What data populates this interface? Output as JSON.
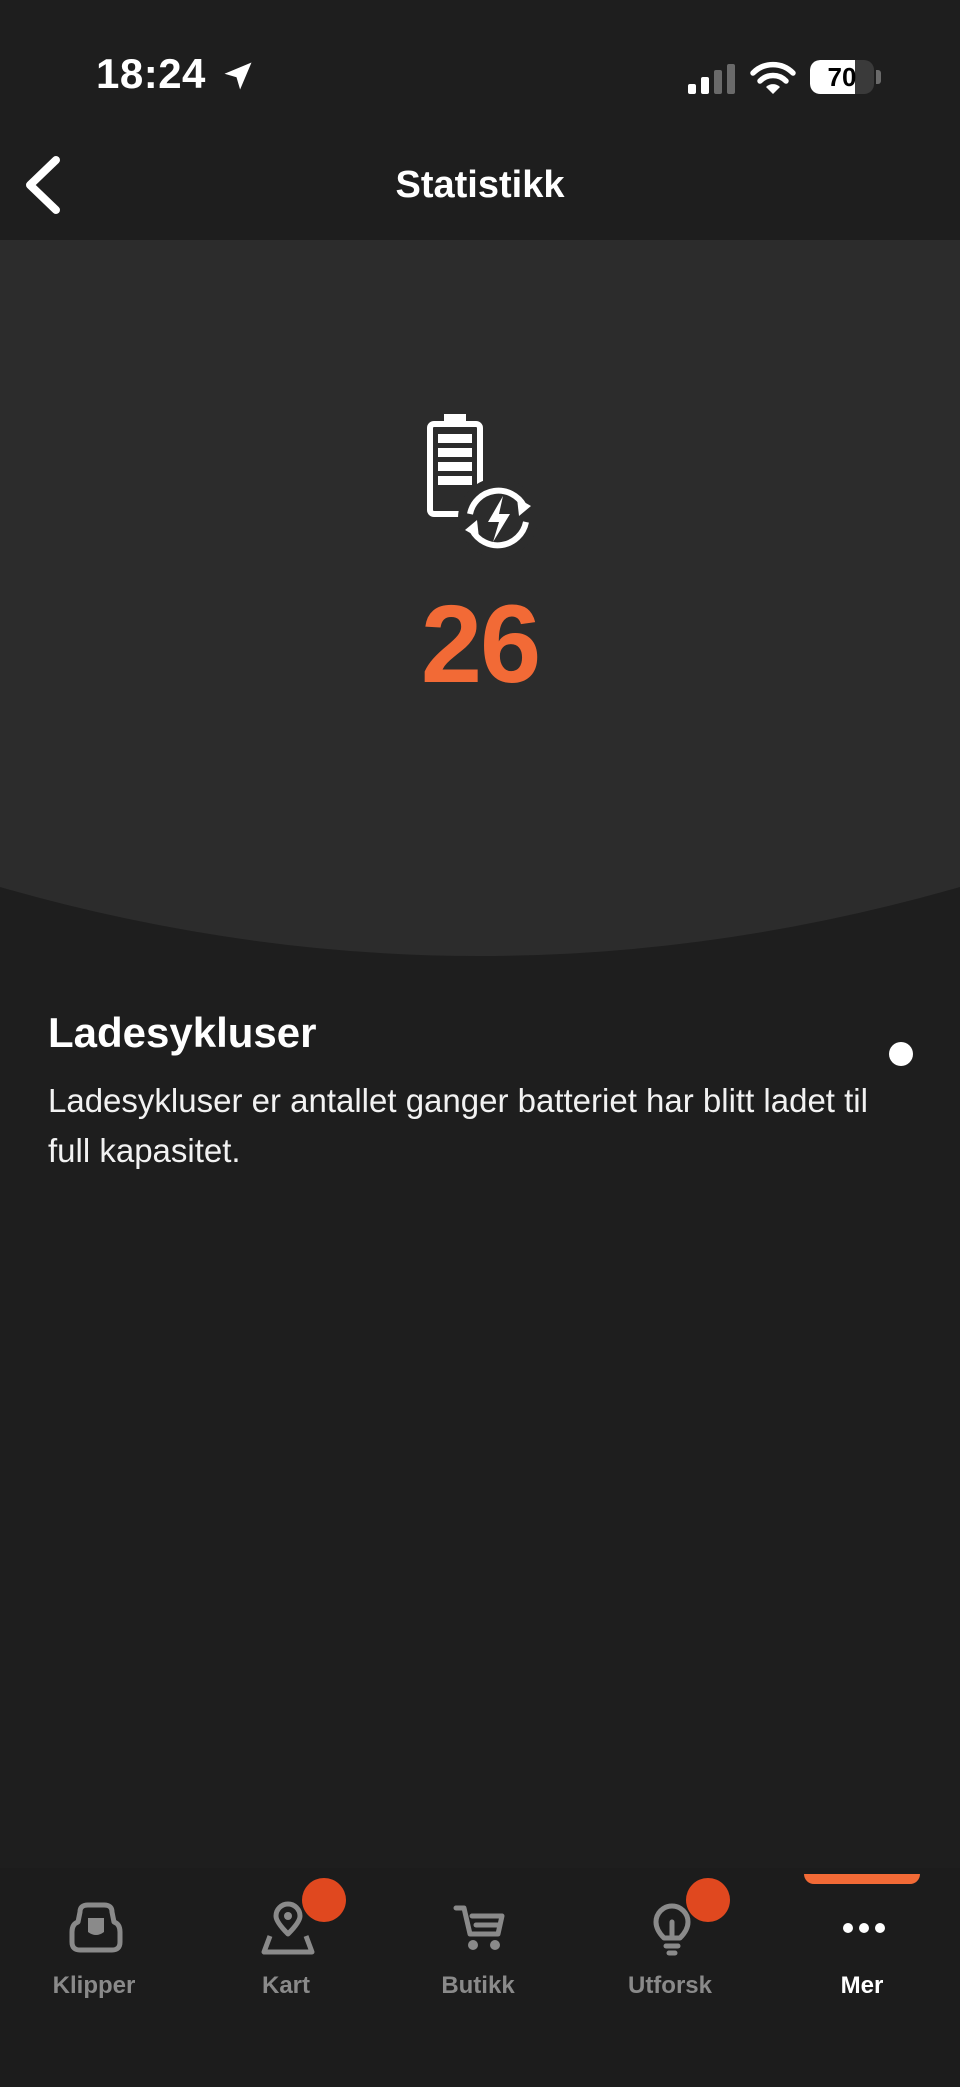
{
  "status_bar": {
    "time": "18:24",
    "battery_percent": "70",
    "battery_level": 0.7,
    "signal_bars_active": 2,
    "signal_bars_total": 4
  },
  "header": {
    "title": "Statistikk"
  },
  "hero": {
    "value": "26",
    "icon": "battery-charge-cycle-icon"
  },
  "info": {
    "title": "Ladesykluser",
    "description": "Ladesykluser er antallet ganger batteriet har blitt ladet til full kapasitet."
  },
  "tab_bar": {
    "active_index": 4,
    "items": [
      {
        "label": "Klipper",
        "icon": "mower-icon",
        "badge": false
      },
      {
        "label": "Kart",
        "icon": "map-pin-icon",
        "badge": true
      },
      {
        "label": "Butikk",
        "icon": "cart-icon",
        "badge": false
      },
      {
        "label": "Utforsk",
        "icon": "lightbulb-icon",
        "badge": true
      },
      {
        "label": "Mer",
        "icon": "more-dots-icon",
        "badge": false
      }
    ]
  },
  "colors": {
    "accent": "#f26a36",
    "badge": "#e0481f",
    "background": "#1e1e1e",
    "hero_background": "#2c2c2c",
    "tab_inactive": "#8a8a8a",
    "tab_active": "#ffffff"
  }
}
